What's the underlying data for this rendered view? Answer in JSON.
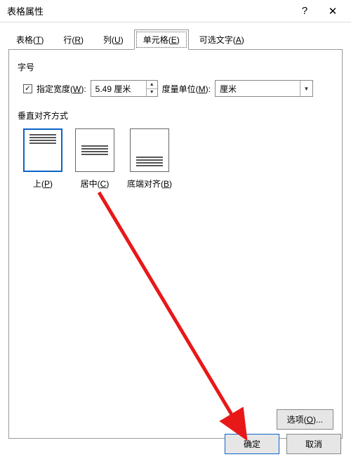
{
  "title": "表格属性",
  "help_glyph": "?",
  "close_glyph": "✕",
  "tabs": {
    "table": {
      "label": "表格(",
      "accel": "T",
      "tail": ")"
    },
    "row": {
      "label": "行(",
      "accel": "R",
      "tail": ")"
    },
    "col": {
      "label": "列(",
      "accel": "U",
      "tail": ")"
    },
    "cell": {
      "label": "单元格(",
      "accel": "E",
      "tail": ")"
    },
    "alt": {
      "label": "可选文字(",
      "accel": "A",
      "tail": ")"
    }
  },
  "size_group_label": "字号",
  "width_checked": "✓",
  "width_label": {
    "pre": "指定宽度(",
    "accel": "W",
    "post": "):"
  },
  "width_value": "5.49 厘米",
  "measure_label": {
    "pre": "度量单位(",
    "accel": "M",
    "post": "):"
  },
  "measure_value": "厘米",
  "valign_group_label": "垂直对齐方式",
  "valign": {
    "top": {
      "pre": "上(",
      "accel": "P",
      "post": ")"
    },
    "center": {
      "pre": "居中(",
      "accel": "C",
      "post": ")"
    },
    "bottom": {
      "pre": "底端对齐(",
      "accel": "B",
      "post": ")"
    }
  },
  "options_label": {
    "pre": "选项(",
    "accel": "O",
    "post": ")..."
  },
  "ok_label": "确定",
  "cancel_label": "取消",
  "spin_up": "▲",
  "spin_down": "▼",
  "combo_arrow": "▼"
}
